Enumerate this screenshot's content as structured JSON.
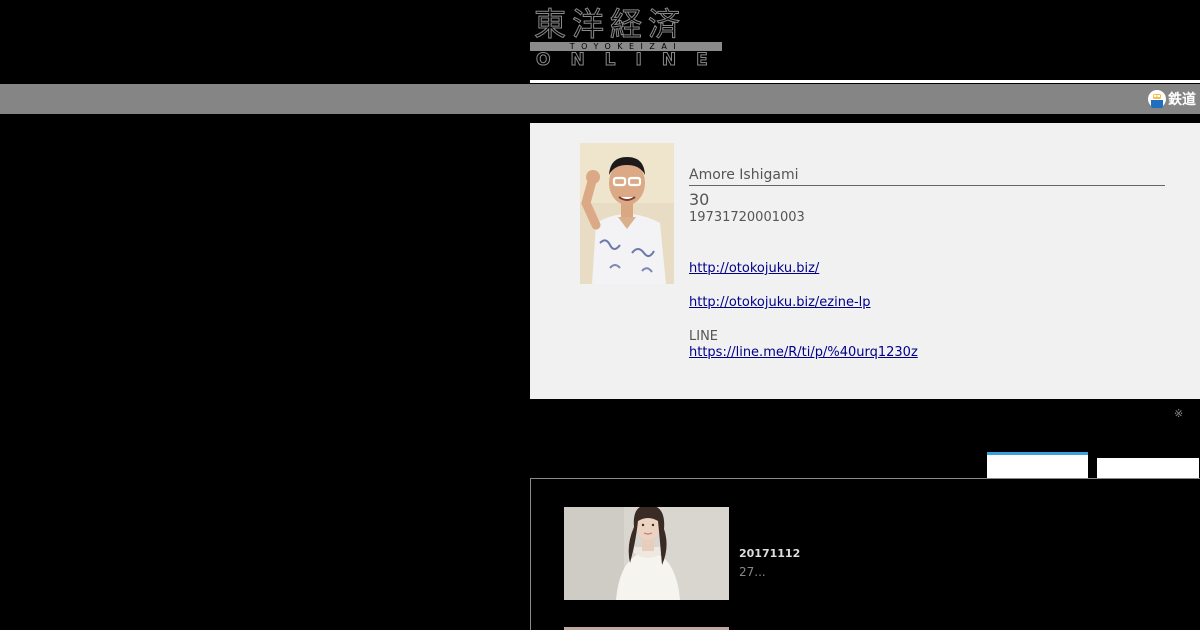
{
  "header": {
    "logo_kanji": "東洋経済",
    "logo_romaji": "TOYOKEIZAI",
    "logo_online": "ONLINE"
  },
  "nav": {
    "item_label": "鉄道",
    "item_icon": "train-icon"
  },
  "profile": {
    "name": "Amore Ishigami",
    "age": "30",
    "id_number": "19731720001003",
    "links": [
      "http://otokojuku.biz/",
      "http://otokojuku.biz/ezine-lp"
    ],
    "line_label": "LINE",
    "line_link": "https://line.me/R/ti/p/%40urq1230z"
  },
  "note_mark": "※",
  "articles": [
    {
      "date": "20171112",
      "excerpt": "27..."
    }
  ],
  "colors": {
    "background": "#000000",
    "navbar": "#858585",
    "card": "#f1f1f1",
    "link": "#00008b",
    "tab_accent": "#3aa0e0"
  }
}
